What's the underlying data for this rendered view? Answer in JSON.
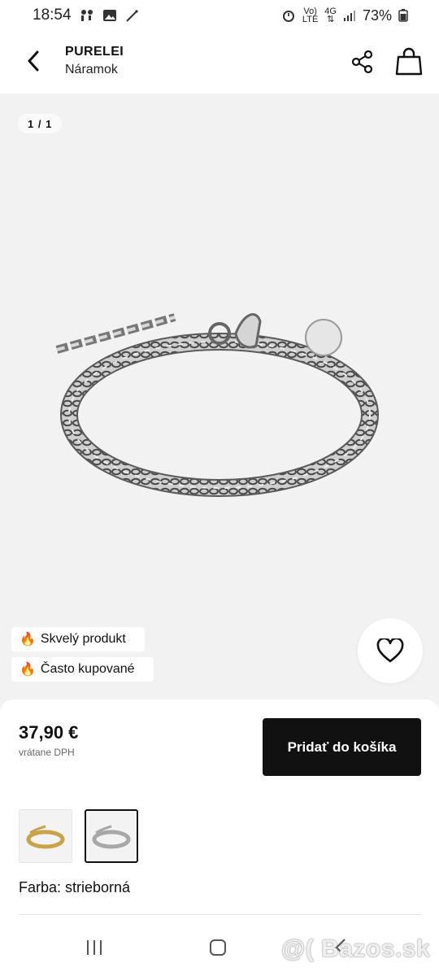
{
  "status_bar": {
    "time": "18:54",
    "signal_top": "Vo)",
    "signal_bottom": "LTE",
    "network_top": "4G",
    "battery": "73%"
  },
  "header": {
    "brand": "PURELEI",
    "subtitle": "Náramok"
  },
  "gallery": {
    "counter": "1 / 1"
  },
  "badges": [
    {
      "icon": "fire-icon",
      "emoji": "🔥",
      "label": "Skvelý produkt"
    },
    {
      "icon": "fire-icon",
      "emoji": "🔥",
      "label": "Často kupované"
    }
  ],
  "purchase": {
    "price": "37,90 €",
    "vat_note": "vrátane DPH",
    "add_to_cart": "Pridať do košíka"
  },
  "variants": {
    "options": [
      {
        "name": "gold",
        "selected": false,
        "color": "#c9a24a"
      },
      {
        "name": "silver",
        "selected": true,
        "color": "#a8a8a8"
      }
    ],
    "color_line": "Farba: strieborná"
  },
  "watermark": "@( Bazos.sk",
  "colors": {
    "accent_button": "#111111",
    "background": "#f2f2f2"
  }
}
